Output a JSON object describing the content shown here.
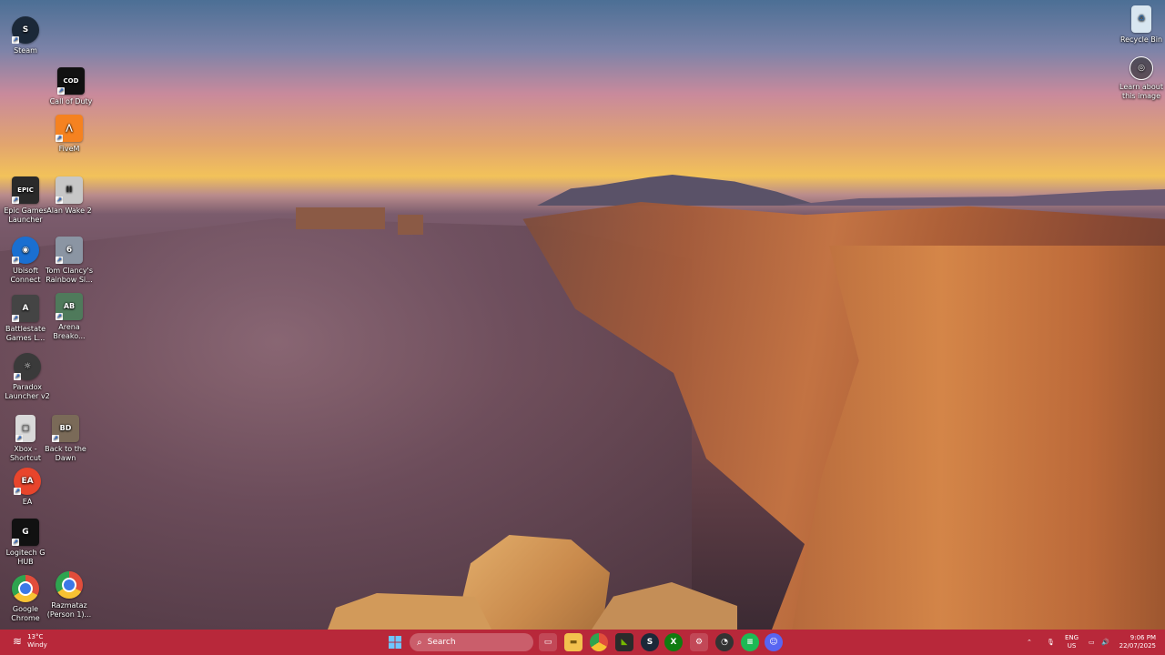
{
  "desktop": {
    "icons": [
      {
        "label": "Steam",
        "icon": "steam-icon",
        "color": "#1b2838",
        "glyph": "S"
      },
      {
        "label": "FiveM",
        "icon": "fivem-icon",
        "color": "#f58220",
        "glyph": "⋀"
      },
      {
        "label": "Call of Duty",
        "icon": "call-of-duty-icon",
        "color": "#111111",
        "glyph": "COD"
      },
      {
        "label": "Epic Games Launcher",
        "icon": "epic-games-icon",
        "color": "#2a2a2a",
        "glyph": "EPIC"
      },
      {
        "label": "Alan Wake 2",
        "icon": "alan-wake-2-icon",
        "color": "#c7c7c7",
        "glyph": "II"
      },
      {
        "label": "Ubisoft Connect",
        "icon": "ubisoft-connect-icon",
        "color": "#1a6fd1",
        "glyph": "◉"
      },
      {
        "label": "Tom Clancy's Rainbow Si...",
        "icon": "rainbow-six-icon",
        "color": "#8b95a3",
        "glyph": "6"
      },
      {
        "label": "Battlestate Games L...",
        "icon": "battlestate-icon",
        "color": "#444444",
        "glyph": "A"
      },
      {
        "label": "Arena Breako...",
        "icon": "arena-breakout-icon",
        "color": "#4f7a5b",
        "glyph": "AB"
      },
      {
        "label": "Paradox Launcher v2",
        "icon": "paradox-launcher-icon",
        "color": "#3a3a3a",
        "glyph": "☼"
      },
      {
        "label": "Xbox - Shortcut",
        "icon": "xbox-shortcut-icon",
        "color": "#d9d9d9",
        "glyph": "▢"
      },
      {
        "label": "Back to the Dawn",
        "icon": "back-to-the-dawn-icon",
        "color": "#7a6a58",
        "glyph": "BD"
      },
      {
        "label": "EA",
        "icon": "ea-icon",
        "color": "#e8452c",
        "glyph": "EA"
      },
      {
        "label": "Logitech G HUB",
        "icon": "logitech-g-hub-icon",
        "color": "#111111",
        "glyph": "G"
      },
      {
        "label": "Google Chrome",
        "icon": "chrome-icon",
        "color": "#e14d3b",
        "glyph": "●"
      },
      {
        "label": "Razmataz (Person 1)...",
        "icon": "chrome-profile-icon",
        "color": "#e14d3b",
        "glyph": "R"
      },
      {
        "label": "Recycle Bin",
        "icon": "recycle-bin-icon",
        "color": "#d8e6f0",
        "glyph": "♻"
      },
      {
        "label": "Learn about this image",
        "icon": "camera-info-icon",
        "color": "#444444",
        "glyph": "◎"
      }
    ]
  },
  "taskbar": {
    "weather": {
      "temp": "13°C",
      "condition": "Windy"
    },
    "search_placeholder": "Search",
    "language": {
      "lang": "ENG",
      "region": "US"
    },
    "clock": {
      "time": "9:06 PM",
      "date": "22/07/2025"
    }
  }
}
